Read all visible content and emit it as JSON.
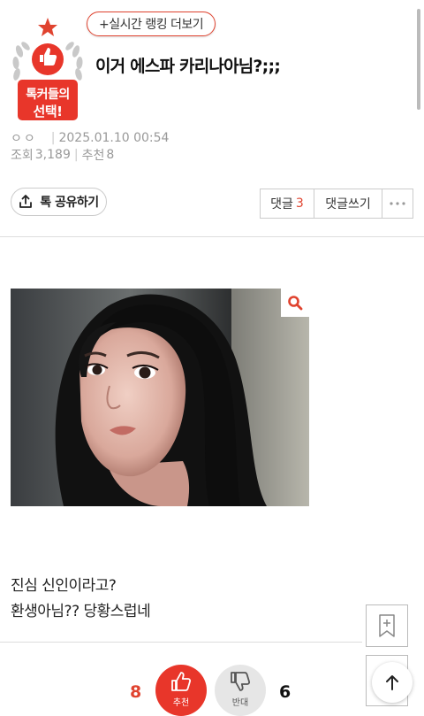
{
  "header": {
    "ranking_link": "+실시간 랭킹 더보기",
    "title": "이거 에스파 카리나아님?;;;",
    "badge": {
      "line1": "톡커들의",
      "line2": "선택!"
    }
  },
  "meta": {
    "author": "ㅇㅇ",
    "date": "2025.01.10 00:54",
    "views_label": "조회",
    "views": "3,189",
    "recommend_label": "추천",
    "recommend": "8"
  },
  "actions": {
    "share": "톡 공유하기",
    "comments_label": "댓글",
    "comments_count": "3",
    "write_comment": "댓글쓰기"
  },
  "post": {
    "line1": "진심 신인이라고?",
    "line2": "환생아님?? 당황스럽네"
  },
  "votes": {
    "up_count": "8",
    "up_label": "추천",
    "down_label": "반대",
    "down_count": "6"
  },
  "colors": {
    "accent": "#e0432f",
    "badge_red": "#e8362a"
  },
  "icons": [
    "thumbs-up-icon",
    "share-icon",
    "more-icon",
    "search-icon",
    "bookmark-add-icon",
    "arrow-up-icon",
    "thumbs-down-icon"
  ]
}
